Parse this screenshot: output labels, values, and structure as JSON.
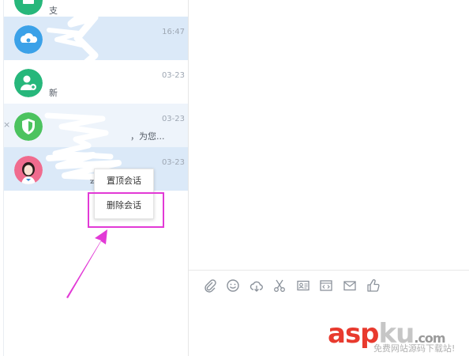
{
  "conversations": [
    {
      "name": "",
      "preview": "支",
      "time": "",
      "avatar": "green-list-icon",
      "state": "normal"
    },
    {
      "name": "",
      "preview": "",
      "time": "16:47",
      "avatar": "blue-cloud-icon",
      "state": "selected"
    },
    {
      "name": "",
      "preview": "新",
      "time": "03-23",
      "avatar": "green-add-user-icon",
      "state": "normal"
    },
    {
      "name": "",
      "preview": "，为您...",
      "time": "03-23",
      "avatar": "green-shield-icon",
      "state": "hover"
    },
    {
      "name": "",
      "preview": "会",
      "time": "03-23",
      "avatar": "pink-girl-avatar",
      "state": "selected"
    }
  ],
  "close_glyph": "×",
  "context_menu": {
    "items": [
      "置顶会话",
      "删除会话"
    ]
  },
  "toolbar": {
    "icons": [
      "paperclip-icon",
      "emoji-icon",
      "cloud-upload-icon",
      "scissors-icon",
      "contact-card-icon",
      "code-snippet-icon",
      "mail-icon",
      "thumbs-up-icon"
    ]
  },
  "watermark": {
    "main_red": "asp",
    "main_gray": "ku",
    "domain": ".com",
    "sub": "免费网站源码下载站!"
  },
  "colors": {
    "selected_bg": "#dbe9f8",
    "hover_bg": "#eef4fb",
    "highlight": "#e23ad6",
    "arrow": "#e23ad6"
  }
}
